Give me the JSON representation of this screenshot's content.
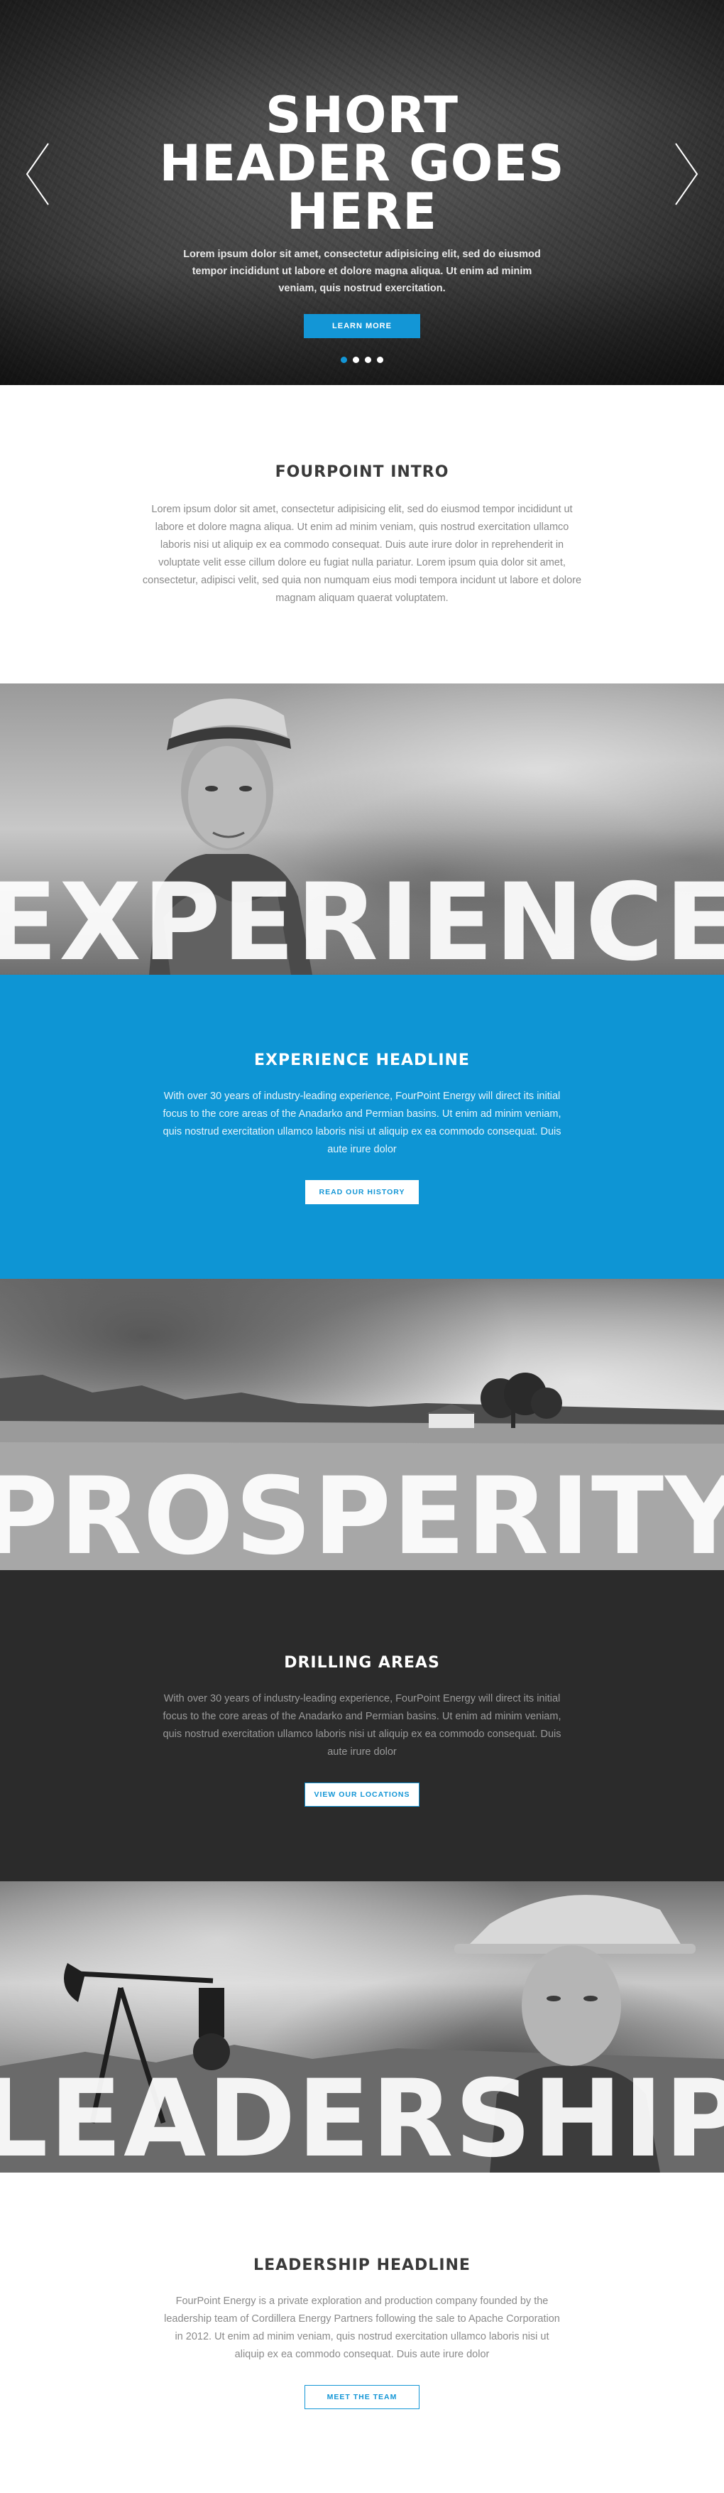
{
  "hero": {
    "title": "SHORT HEADER GOES HERE",
    "text": "Lorem ipsum dolor sit amet, consectetur adipisicing elit, sed do eiusmod tempor incididunt ut labore et dolore magna aliqua. Ut enim ad minim veniam, quis nostrud exercitation.",
    "button_label": "LEARN MORE",
    "slides": 4,
    "active_slide": 1
  },
  "intro": {
    "heading": "FOURPOINT INTRO",
    "text": "Lorem ipsum dolor sit amet, consectetur adipisicing elit, sed do eiusmod tempor incididunt ut labore et dolore magna aliqua. Ut enim ad minim veniam, quis nostrud exercitation ullamco laboris nisi ut aliquip ex ea commodo consequat. Duis aute irure dolor in reprehenderit in voluptate velit esse cillum dolore eu fugiat nulla pariatur. Lorem ipsum quia dolor sit amet, consectetur, adipisci velit, sed quia non numquam eius modi tempora incidunt ut labore et dolore magnam aliquam quaerat voluptatem."
  },
  "experience": {
    "band_word": "EXPERIENCE",
    "heading": "EXPERIENCE HEADLINE",
    "text": "With over 30 years of industry-leading experience, FourPoint Energy will direct its initial focus to the core areas of the Anadarko and Permian basins. Ut enim ad minim veniam, quis nostrud exercitation ullamco laboris nisi ut aliquip ex ea commodo consequat. Duis aute irure dolor",
    "button_label": "READ OUR HISTORY"
  },
  "prosperity": {
    "band_word": "PROSPERITY",
    "heading": "DRILLING AREAS",
    "text": "With over 30 years of industry-leading experience, FourPoint Energy will direct its initial focus to the core areas of the Anadarko and Permian basins. Ut enim ad minim veniam, quis nostrud exercitation ullamco laboris nisi ut aliquip ex ea commodo consequat. Duis aute irure dolor",
    "button_label": "VIEW OUR LOCATIONS"
  },
  "leadership": {
    "band_word": "LEADERSHIP",
    "heading": "LEADERSHIP HEADLINE",
    "text": "FourPoint Energy is a private exploration and production company founded by the leadership team of Cordillera Energy Partners following the sale to Apache Corporation in 2012. Ut enim ad minim veniam, quis nostrud exercitation ullamco laboris nisi ut aliquip ex ea commodo consequat. Duis aute irure dolor",
    "button_label": "MEET THE TEAM"
  },
  "colors": {
    "accent": "#1396d6",
    "dark": "#2b2b2b"
  },
  "icons": {
    "prev": "chevron-left-icon",
    "next": "chevron-right-icon"
  }
}
